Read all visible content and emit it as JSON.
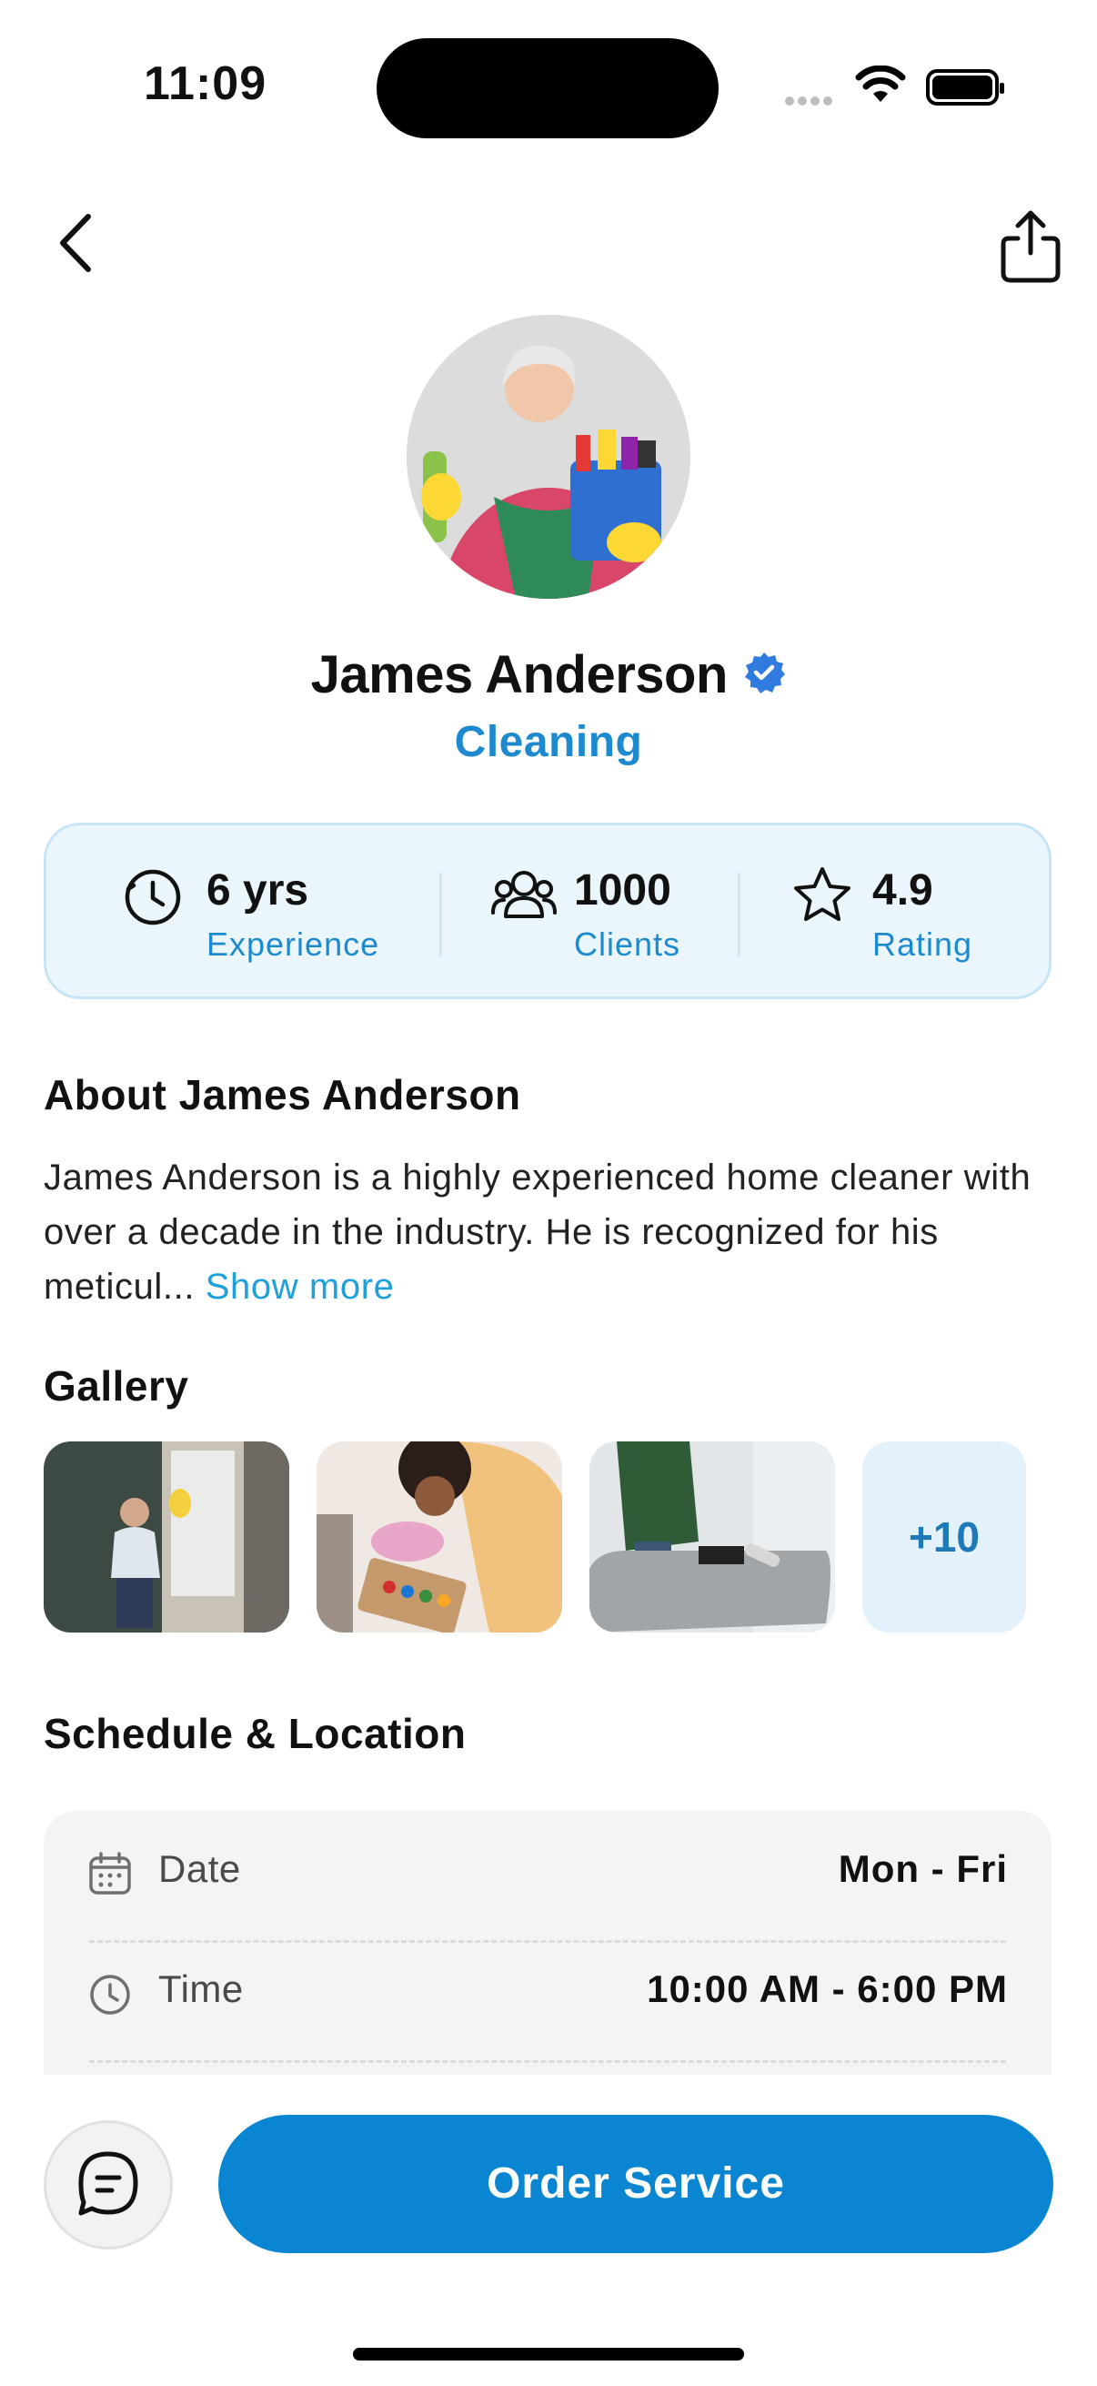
{
  "status_bar": {
    "time": "11:09"
  },
  "profile": {
    "name": "James Anderson",
    "category": "Cleaning"
  },
  "stats": [
    {
      "value": "6 yrs",
      "label": "Experience",
      "icon": "clock-icon"
    },
    {
      "value": "1000",
      "label": "Clients",
      "icon": "users-icon"
    },
    {
      "value": "4.9",
      "label": "Rating",
      "icon": "star-icon"
    }
  ],
  "about": {
    "title": "About James Anderson",
    "text": "James Anderson is a highly experienced home cleaner with over a decade in the industry. He is recognized for his meticul...",
    "show_more": "Show more"
  },
  "gallery": {
    "title": "Gallery",
    "more_label": "+10"
  },
  "schedule": {
    "title": "Schedule & Location",
    "rows": [
      {
        "label": "Date",
        "value": "Mon - Fri",
        "icon": "calendar-icon"
      },
      {
        "label": "Time",
        "value": "10:00 AM - 6:00 PM",
        "icon": "clock-icon"
      }
    ]
  },
  "actions": {
    "order_label": "Order Service"
  },
  "colors": {
    "accent": "#0a85d1",
    "accent_text": "#1d8ad0",
    "stats_bg": "#eaf6fc",
    "stats_border": "#c7e4f6"
  }
}
